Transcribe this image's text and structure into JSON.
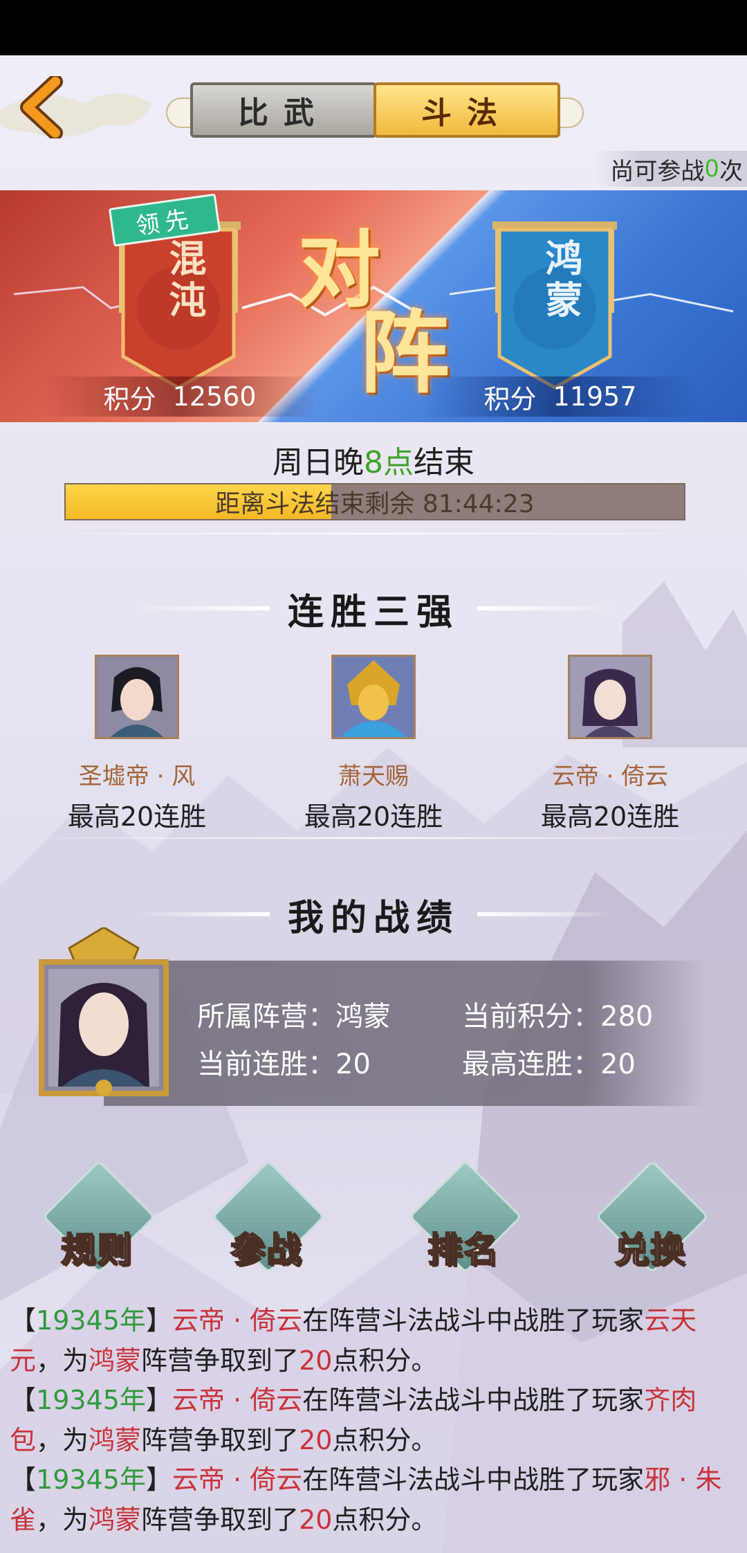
{
  "header": {
    "tabs": [
      {
        "label": "比武",
        "active": false
      },
      {
        "label": "斗法",
        "active": true
      }
    ],
    "remaining": {
      "prefix": "尚可参战",
      "count": "0",
      "suffix": "次"
    }
  },
  "battle": {
    "left": {
      "name": "混沌",
      "score_label": "积分",
      "score": "12560",
      "lead_badge": "领先"
    },
    "right": {
      "name": "鸿蒙",
      "score_label": "积分",
      "score": "11957"
    },
    "vs_chars": [
      "对",
      "阵"
    ]
  },
  "countdown": {
    "end_prefix": "周日晚",
    "end_highlight": "8点",
    "end_suffix": "结束",
    "text": "距离斗法结束剩余 81:44:23",
    "progress": 0.43
  },
  "top_three": {
    "title": "连胜三强",
    "players": [
      {
        "name": "圣墟帝 · 风",
        "streak": "最高20连胜"
      },
      {
        "name": "萧天赐",
        "streak": "最高20连胜"
      },
      {
        "name": "云帝 · 倚云",
        "streak": "最高20连胜"
      }
    ]
  },
  "my_record": {
    "title": "我的战绩",
    "camp_label": "所属阵营：",
    "camp": "鸿蒙",
    "score_label": "当前积分：",
    "score": "280",
    "streak_label": "当前连胜：",
    "streak": "20",
    "max_label": "最高连胜：",
    "max_streak": "20"
  },
  "actions": [
    {
      "label": "规则"
    },
    {
      "label": "参战"
    },
    {
      "label": "排名"
    },
    {
      "label": "兑换"
    }
  ],
  "logs": [
    {
      "year": "19345年",
      "winner": "云帝 · 倚云",
      "mid": "在阵营斗法战斗中战胜了玩家",
      "loser": "云天元",
      "comma": "，为",
      "camp": "鸿蒙",
      "mid2": "阵营争取到了",
      "points": "20",
      "tail": "点积分。"
    },
    {
      "year": "19345年",
      "winner": "云帝 · 倚云",
      "mid": "在阵营斗法战斗中战胜了玩家",
      "loser": "齐肉包",
      "comma": "，为",
      "camp": "鸿蒙",
      "mid2": "阵营争取到了",
      "points": "20",
      "tail": "点积分。"
    },
    {
      "year": "19345年",
      "winner": "云帝 · 倚云",
      "mid": "在阵营斗法战斗中战胜了玩家",
      "loser": "邪 · 朱雀",
      "comma": "，为",
      "camp": "鸿蒙",
      "mid2": "阵营争取到了",
      "points": "20",
      "tail": "点积分。"
    }
  ],
  "colors": {
    "accent_green": "#3fbf2a",
    "red_text": "#c8333b",
    "gold": "#f5b824"
  }
}
